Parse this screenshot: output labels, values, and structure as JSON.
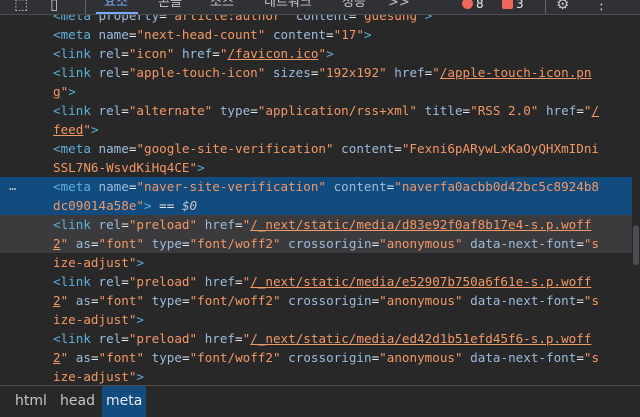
{
  "toolbar": {
    "tabs": [
      "요소",
      "콘솔",
      "소스",
      "네트워크",
      "성능"
    ],
    "more_label": ">>",
    "errors_count": "8",
    "warnings_count": "3",
    "more_menu_label": "⋮"
  },
  "code_lines": [
    {
      "segments": [
        [
          "t-tag",
          "<"
        ],
        [
          "t-tag",
          "meta "
        ],
        [
          "t-attr",
          "property"
        ],
        [
          "t-eq",
          "="
        ],
        [
          "t-val",
          "\"article:author\""
        ],
        [
          "t-eq",
          " "
        ],
        [
          "t-attr",
          "content"
        ],
        [
          "t-eq",
          "="
        ],
        [
          "t-val",
          "\"guesung\""
        ],
        [
          "t-tag",
          ">"
        ]
      ]
    },
    {
      "segments": [
        [
          "t-tag",
          "<meta "
        ],
        [
          "t-attr",
          "name"
        ],
        [
          "t-eq",
          "="
        ],
        [
          "t-val",
          "\"next-head-count\""
        ],
        [
          "t-eq",
          " "
        ],
        [
          "t-attr",
          "content"
        ],
        [
          "t-eq",
          "="
        ],
        [
          "t-val",
          "\"17\""
        ],
        [
          "t-tag",
          ">"
        ]
      ]
    },
    {
      "segments": [
        [
          "t-tag",
          "<link "
        ],
        [
          "t-attr",
          "rel"
        ],
        [
          "t-eq",
          "="
        ],
        [
          "t-val",
          "\"icon\""
        ],
        [
          "t-eq",
          " "
        ],
        [
          "t-attr",
          "href"
        ],
        [
          "t-eq",
          "="
        ],
        [
          "t-val",
          "\""
        ],
        [
          "t-link",
          "/favicon.ico"
        ],
        [
          "t-val",
          "\""
        ],
        [
          "t-tag",
          ">"
        ]
      ]
    },
    {
      "segments": [
        [
          "t-tag",
          "<link "
        ],
        [
          "t-attr",
          "rel"
        ],
        [
          "t-eq",
          "="
        ],
        [
          "t-val",
          "\"apple-touch-icon\""
        ],
        [
          "t-eq",
          " "
        ],
        [
          "t-attr",
          "sizes"
        ],
        [
          "t-eq",
          "="
        ],
        [
          "t-val",
          "\"192x192\""
        ],
        [
          "t-eq",
          " "
        ],
        [
          "t-attr",
          "href"
        ],
        [
          "t-eq",
          "="
        ],
        [
          "t-val",
          "\""
        ],
        [
          "t-link",
          "/apple-touch-icon.pn"
        ]
      ]
    },
    {
      "segments": [
        [
          "t-link",
          "g"
        ],
        [
          "t-val",
          "\""
        ],
        [
          "t-tag",
          ">"
        ]
      ],
      "continuation": true
    },
    {
      "segments": [
        [
          "t-tag",
          "<link "
        ],
        [
          "t-attr",
          "rel"
        ],
        [
          "t-eq",
          "="
        ],
        [
          "t-val",
          "\"alternate\""
        ],
        [
          "t-eq",
          " "
        ],
        [
          "t-attr",
          "type"
        ],
        [
          "t-eq",
          "="
        ],
        [
          "t-val",
          "\"application/rss+xml\""
        ],
        [
          "t-eq",
          " "
        ],
        [
          "t-attr",
          "title"
        ],
        [
          "t-eq",
          "="
        ],
        [
          "t-val",
          "\"RSS 2.0\""
        ],
        [
          "t-eq",
          " "
        ],
        [
          "t-attr",
          "href"
        ],
        [
          "t-eq",
          "="
        ],
        [
          "t-val",
          "\""
        ],
        [
          "t-link",
          "/"
        ]
      ]
    },
    {
      "segments": [
        [
          "t-link",
          "feed"
        ],
        [
          "t-val",
          "\""
        ],
        [
          "t-tag",
          ">"
        ]
      ],
      "continuation": true
    },
    {
      "segments": [
        [
          "t-tag",
          "<meta "
        ],
        [
          "t-attr",
          "name"
        ],
        [
          "t-eq",
          "="
        ],
        [
          "t-val",
          "\"google-site-verification\""
        ],
        [
          "t-eq",
          " "
        ],
        [
          "t-attr",
          "content"
        ],
        [
          "t-eq",
          "="
        ],
        [
          "t-val",
          "\"Fexni6pARywLxKaOyQHXmIDni"
        ]
      ]
    },
    {
      "segments": [
        [
          "t-val",
          "SSL7N6-WsvdKiHq4CE\""
        ],
        [
          "t-tag",
          ">"
        ]
      ],
      "continuation": true
    },
    {
      "segments": [
        [
          "t-tag",
          "<meta "
        ],
        [
          "t-attr",
          "name"
        ],
        [
          "t-eq",
          "="
        ],
        [
          "t-val",
          "\"naver-site-verification\""
        ],
        [
          "t-eq",
          " "
        ],
        [
          "t-attr",
          "content"
        ],
        [
          "t-eq",
          "="
        ],
        [
          "t-val",
          "\"naverfa0acbb0d42bc5c8924b8"
        ]
      ],
      "selected": true,
      "ellipsis": true
    },
    {
      "segments": [
        [
          "t-val",
          "dc09014a58e\""
        ],
        [
          "t-tag",
          ">"
        ],
        [
          "t-eq",
          " == "
        ],
        [
          "t-dollar",
          "$0"
        ]
      ],
      "continuation": true,
      "selected": true
    },
    {
      "segments": [
        [
          "t-tag",
          "<link "
        ],
        [
          "t-attr",
          "rel"
        ],
        [
          "t-eq",
          "="
        ],
        [
          "t-val",
          "\"preload\""
        ],
        [
          "t-eq",
          " "
        ],
        [
          "t-attr",
          "href"
        ],
        [
          "t-eq",
          "="
        ],
        [
          "t-val",
          "\""
        ],
        [
          "t-link",
          "/_next/static/media/d83e92f0af8b17e4-s.p.woff"
        ]
      ],
      "hovered": true
    },
    {
      "segments": [
        [
          "t-link",
          "2"
        ],
        [
          "t-val",
          "\""
        ],
        [
          "t-eq",
          " "
        ],
        [
          "t-attr",
          "as"
        ],
        [
          "t-eq",
          "="
        ],
        [
          "t-val",
          "\"font\""
        ],
        [
          "t-eq",
          " "
        ],
        [
          "t-attr",
          "type"
        ],
        [
          "t-eq",
          "="
        ],
        [
          "t-val",
          "\"font/woff2\""
        ],
        [
          "t-eq",
          " "
        ],
        [
          "t-attr",
          "crossorigin"
        ],
        [
          "t-eq",
          "="
        ],
        [
          "t-val",
          "\"anonymous\""
        ],
        [
          "t-eq",
          " "
        ],
        [
          "t-attr",
          "data-next-font"
        ],
        [
          "t-eq",
          "="
        ],
        [
          "t-val",
          "\"s"
        ]
      ],
      "continuation": true,
      "hovered": true
    },
    {
      "segments": [
        [
          "t-val",
          "ize-adjust\""
        ],
        [
          "t-tag",
          ">"
        ]
      ],
      "continuation": true
    },
    {
      "segments": [
        [
          "t-tag",
          "<link "
        ],
        [
          "t-attr",
          "rel"
        ],
        [
          "t-eq",
          "="
        ],
        [
          "t-val",
          "\"preload\""
        ],
        [
          "t-eq",
          " "
        ],
        [
          "t-attr",
          "href"
        ],
        [
          "t-eq",
          "="
        ],
        [
          "t-val",
          "\""
        ],
        [
          "t-link",
          "/_next/static/media/e52907b750a6f61e-s.p.woff"
        ]
      ]
    },
    {
      "segments": [
        [
          "t-link",
          "2"
        ],
        [
          "t-val",
          "\""
        ],
        [
          "t-eq",
          " "
        ],
        [
          "t-attr",
          "as"
        ],
        [
          "t-eq",
          "="
        ],
        [
          "t-val",
          "\"font\""
        ],
        [
          "t-eq",
          " "
        ],
        [
          "t-attr",
          "type"
        ],
        [
          "t-eq",
          "="
        ],
        [
          "t-val",
          "\"font/woff2\""
        ],
        [
          "t-eq",
          " "
        ],
        [
          "t-attr",
          "crossorigin"
        ],
        [
          "t-eq",
          "="
        ],
        [
          "t-val",
          "\"anonymous\""
        ],
        [
          "t-eq",
          " "
        ],
        [
          "t-attr",
          "data-next-font"
        ],
        [
          "t-eq",
          "="
        ],
        [
          "t-val",
          "\"s"
        ]
      ],
      "continuation": true
    },
    {
      "segments": [
        [
          "t-val",
          "ize-adjust\""
        ],
        [
          "t-tag",
          ">"
        ]
      ],
      "continuation": true
    },
    {
      "segments": [
        [
          "t-tag",
          "<link "
        ],
        [
          "t-attr",
          "rel"
        ],
        [
          "t-eq",
          "="
        ],
        [
          "t-val",
          "\"preload\""
        ],
        [
          "t-eq",
          " "
        ],
        [
          "t-attr",
          "href"
        ],
        [
          "t-eq",
          "="
        ],
        [
          "t-val",
          "\""
        ],
        [
          "t-link",
          "/_next/static/media/ed42d1b51efd45f6-s.p.woff"
        ]
      ]
    },
    {
      "segments": [
        [
          "t-link",
          "2"
        ],
        [
          "t-val",
          "\""
        ],
        [
          "t-eq",
          " "
        ],
        [
          "t-attr",
          "as"
        ],
        [
          "t-eq",
          "="
        ],
        [
          "t-val",
          "\"font\""
        ],
        [
          "t-eq",
          " "
        ],
        [
          "t-attr",
          "type"
        ],
        [
          "t-eq",
          "="
        ],
        [
          "t-val",
          "\"font/woff2\""
        ],
        [
          "t-eq",
          " "
        ],
        [
          "t-attr",
          "crossorigin"
        ],
        [
          "t-eq",
          "="
        ],
        [
          "t-val",
          "\"anonymous\""
        ],
        [
          "t-eq",
          " "
        ],
        [
          "t-attr",
          "data-next-font"
        ],
        [
          "t-eq",
          "="
        ],
        [
          "t-val",
          "\"s"
        ]
      ],
      "continuation": true
    },
    {
      "segments": [
        [
          "t-val",
          "ize-adjust\""
        ],
        [
          "t-tag",
          ">"
        ]
      ],
      "continuation": true
    }
  ],
  "ellipsis_label": "…",
  "breadcrumbs": [
    "html",
    "head",
    "meta"
  ],
  "colors": {
    "background": "#282828",
    "selected_row": "#124b7e",
    "tag": "#5db0d7",
    "attribute": "#9bbbdc",
    "value": "#f29766",
    "error": "#ee675c",
    "active_tab": "#7cacf8"
  }
}
